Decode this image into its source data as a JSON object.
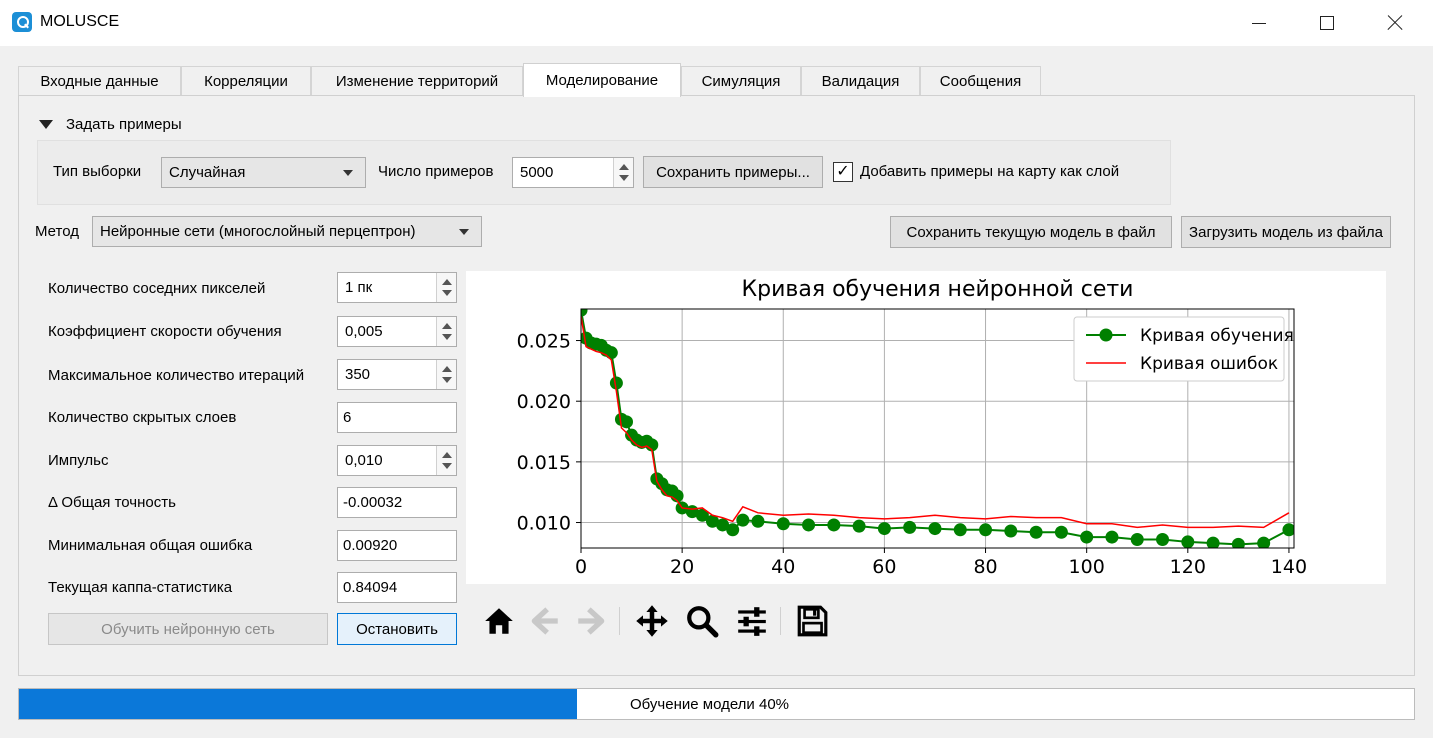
{
  "window": {
    "title": "MOLUSCE"
  },
  "tabs": [
    {
      "label": "Входные данные",
      "active": false
    },
    {
      "label": "Корреляции",
      "active": false
    },
    {
      "label": "Изменение территорий",
      "active": false
    },
    {
      "label": "Моделирование",
      "active": true
    },
    {
      "label": "Симуляция",
      "active": false
    },
    {
      "label": "Валидация",
      "active": false
    },
    {
      "label": "Сообщения",
      "active": false
    }
  ],
  "samples": {
    "header": "Задать примеры",
    "sampling_type_label": "Тип выборки",
    "sampling_type_value": "Случайная",
    "count_label": "Число примеров",
    "count_value": "5000",
    "save_button": "Сохранить примеры...",
    "add_to_map_checked": true,
    "add_to_map_label": "Добавить примеры на карту как слой"
  },
  "method": {
    "label": "Метод",
    "value": "Нейронные сети (многослойный перцептрон)",
    "save_model_button": "Сохранить текущую модель в файл",
    "load_model_button": "Загрузить модель из файла"
  },
  "params": {
    "neighbours_label": "Количество соседних пикселей",
    "neighbours_value": "1 пк",
    "learning_rate_label": "Коэффициент скорости обучения",
    "learning_rate_value": "0,005",
    "max_iter_label": "Максимальное количество итераций",
    "max_iter_value": "350",
    "hidden_layers_label": "Количество скрытых слоев",
    "hidden_layers_value": "6",
    "momentum_label": "Импульс",
    "momentum_value": "0,010",
    "delta_acc_label": "Δ Общая точность",
    "delta_acc_value": "-0.00032",
    "min_error_label": "Минимальная общая ошибка",
    "min_error_value": "0.00920",
    "kappa_label": "Текущая каппа-статистика",
    "kappa_value": "0.84094",
    "train_button": "Обучить нейронную сеть",
    "stop_button": "Остановить"
  },
  "progress": {
    "value": 40,
    "text": "Обучение модели 40%",
    "color": "#0b78d9"
  },
  "toolbar_icons": [
    "home-icon",
    "back-icon",
    "forward-icon",
    "pan-icon",
    "zoom-icon",
    "configure-icon",
    "save-icon"
  ],
  "chart_data": {
    "type": "line",
    "title": "Кривая обучения нейронной сети",
    "xlim": [
      0,
      141
    ],
    "ylim": [
      0.0079,
      0.0276
    ],
    "xticks": [
      0,
      20,
      40,
      60,
      80,
      100,
      120,
      140
    ],
    "yticks": [
      0.01,
      0.015,
      0.02,
      0.025
    ],
    "ytick_labels": [
      "0.010",
      "0.015",
      "0.020",
      "0.025"
    ],
    "grid": true,
    "legend_position": "top-right",
    "series": [
      {
        "name": "Кривая обучения",
        "color": "#008000",
        "marker": "circle",
        "x": [
          0,
          1,
          2,
          3,
          4,
          5,
          6,
          7,
          8,
          9,
          10,
          11,
          12,
          13,
          14,
          15,
          16,
          17,
          18,
          19,
          20,
          22,
          24,
          26,
          28,
          30,
          32,
          35,
          40,
          45,
          50,
          55,
          60,
          65,
          70,
          75,
          80,
          85,
          90,
          95,
          100,
          105,
          110,
          115,
          120,
          125,
          130,
          135,
          140
        ],
        "y": [
          0.0275,
          0.0252,
          0.0248,
          0.0247,
          0.0246,
          0.0242,
          0.024,
          0.0215,
          0.0185,
          0.0183,
          0.0172,
          0.0168,
          0.0166,
          0.0167,
          0.0164,
          0.0136,
          0.0132,
          0.0127,
          0.0126,
          0.0122,
          0.0112,
          0.0109,
          0.0106,
          0.0101,
          0.0098,
          0.0094,
          0.0102,
          0.0101,
          0.0099,
          0.0098,
          0.0098,
          0.0097,
          0.0095,
          0.0096,
          0.0095,
          0.0094,
          0.0094,
          0.0093,
          0.0092,
          0.0092,
          0.0088,
          0.0088,
          0.0086,
          0.0086,
          0.0084,
          0.0083,
          0.0082,
          0.0083,
          0.0094
        ]
      },
      {
        "name": "Кривая ошибок",
        "color": "#ff0000",
        "x": [
          0,
          1,
          2,
          3,
          4,
          5,
          6,
          7,
          8,
          9,
          10,
          11,
          12,
          13,
          14,
          15,
          16,
          17,
          18,
          19,
          20,
          22,
          24,
          26,
          28,
          30,
          32,
          35,
          40,
          45,
          50,
          55,
          60,
          65,
          70,
          75,
          80,
          85,
          90,
          95,
          100,
          105,
          110,
          115,
          120,
          125,
          130,
          135,
          140
        ],
        "y": [
          0.027,
          0.0245,
          0.0243,
          0.0241,
          0.024,
          0.0238,
          0.0234,
          0.0208,
          0.0178,
          0.0174,
          0.0168,
          0.0164,
          0.0162,
          0.0163,
          0.016,
          0.0134,
          0.0127,
          0.0122,
          0.0121,
          0.0118,
          0.0112,
          0.0111,
          0.0112,
          0.0106,
          0.0104,
          0.0101,
          0.0113,
          0.0108,
          0.0106,
          0.0107,
          0.0106,
          0.0104,
          0.0103,
          0.0104,
          0.0106,
          0.0104,
          0.0103,
          0.0105,
          0.0104,
          0.0104,
          0.0099,
          0.0099,
          0.0096,
          0.0098,
          0.0096,
          0.0096,
          0.0097,
          0.0096,
          0.0108
        ]
      }
    ]
  }
}
